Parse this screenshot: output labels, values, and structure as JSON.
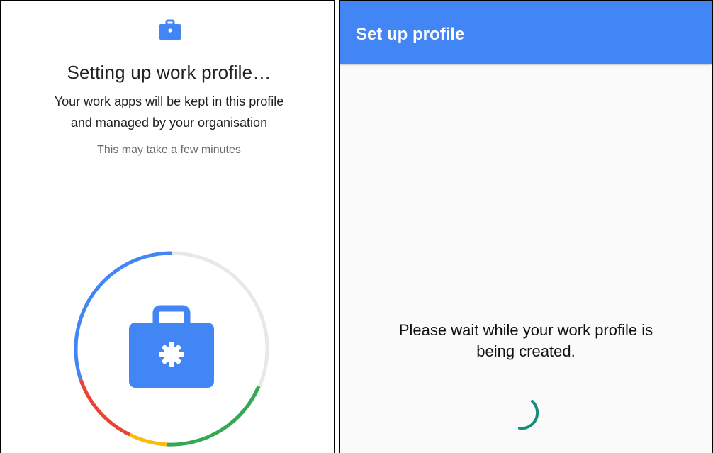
{
  "left": {
    "title": "Setting up work profile…",
    "subtitle_line1": "Your work apps will be kept in this profile",
    "subtitle_line2": "and managed by your organisation",
    "hint": "This may take a few minutes",
    "icons": {
      "top": "work-briefcase-icon",
      "center": "briefcase-gear-icon"
    },
    "colors": {
      "blue": "#4285f4",
      "red": "#ea4335",
      "yellow": "#fbbc05",
      "green": "#34a853",
      "track": "#e8e8e8"
    }
  },
  "right": {
    "appbar_title": "Set up profile",
    "wait_line1": "Please wait while your work profile is",
    "wait_line2": "being created.",
    "spinner_icon": "loading-spinner-icon",
    "colors": {
      "appbar": "#4285f4",
      "spinner": "#1a8a7a"
    }
  }
}
